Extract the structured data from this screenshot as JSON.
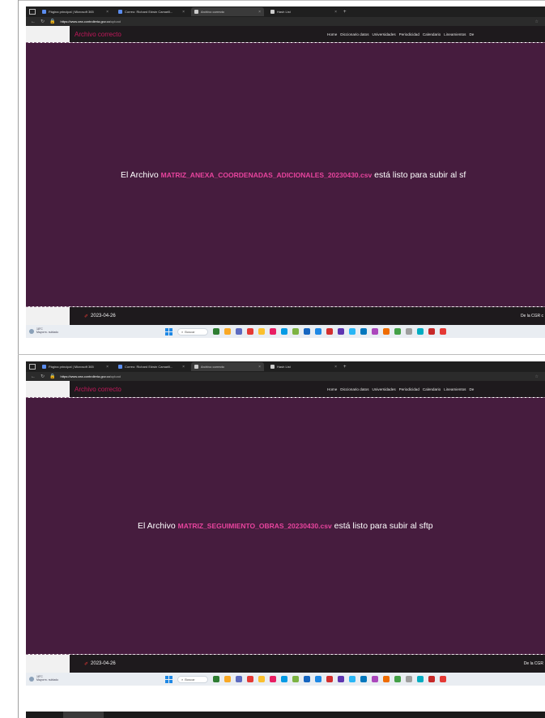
{
  "screens": [
    {
      "tabs": [
        {
          "label": "Página principal | Microsoft 365",
          "active": false
        },
        {
          "label": "Correo: Richard Edwin Camarill...",
          "active": false
        },
        {
          "label": "Archivo correcto",
          "active": true
        },
        {
          "label": "Hash List",
          "active": false
        }
      ],
      "url_domain": "https://www.cea.controlleria.gov.co",
      "url_path": "/upload",
      "brand": "Archivo correcto",
      "nav": [
        "Home",
        "Diccionario datos",
        "Universidades",
        "Periodicidad",
        "Calendario",
        "Lineamientos",
        "De"
      ],
      "message_prefix": "El Archivo",
      "filename": "MATRIZ_ANEXA_COORDENADAS_ADICIONALES_20230430.csv",
      "message_suffix": "está listo para subir al sf",
      "footer_date": "2023-04-26",
      "footer_right": "De la CGR c",
      "weather_temp": "18°C",
      "weather_desc": "Mayorm. nublado",
      "search_label": "Buscar"
    },
    {
      "tabs": [
        {
          "label": "Página principal | Microsoft 365",
          "active": false
        },
        {
          "label": "Correo: Richard Edwin Camarill...",
          "active": false
        },
        {
          "label": "Archivo correcto",
          "active": true
        },
        {
          "label": "Hash List",
          "active": false
        }
      ],
      "url_domain": "https://www.cea.controlleria.gov.co",
      "url_path": "/upload",
      "brand": "Archivo correcto",
      "nav": [
        "Home",
        "Diccionario datos",
        "Universidades",
        "Periodicidad",
        "Calendario",
        "Lineamientos",
        "De"
      ],
      "message_prefix": "El Archivo",
      "filename": "MATRIZ_SEGUIMIENTO_OBRAS_20230430.csv",
      "message_suffix": "está listo para subir al sftp",
      "footer_date": "2023-04-26",
      "footer_right": "De la CGR",
      "weather_temp": "18°C",
      "weather_desc": "Mayorm. nublado",
      "search_label": "Buscar"
    }
  ],
  "colors": {
    "content_bg": "#461c3e",
    "header_bg": "#1e1a1d",
    "brand": "#c2185b",
    "filename": "#e8449e"
  },
  "taskbar_icons": [
    "files-icon",
    "explorer-icon",
    "teams-icon",
    "opera-icon",
    "chrome-icon",
    "paint-icon",
    "edge-icon",
    "notes-icon",
    "mail-icon",
    "word-icon",
    "office-icon",
    "vpn-icon",
    "cloud-icon",
    "outlook-icon",
    "circle-app-icon",
    "maps-icon",
    "green-app-icon",
    "music-icon",
    "browser-icon",
    "pdf-icon",
    "red-app-icon"
  ],
  "taskbar_colors": [
    "#2e7d32",
    "#f9a825",
    "#5c6bc0",
    "#e53935",
    "#fbc02d",
    "#e91e63",
    "#039be5",
    "#7cb342",
    "#1565c0",
    "#1e88e5",
    "#d32f2f",
    "#5e35b1",
    "#29b6f6",
    "#0277bd",
    "#ab47bc",
    "#ef6c00",
    "#43a047",
    "#9e9e9e",
    "#00acc1",
    "#c62828",
    "#e53935"
  ]
}
